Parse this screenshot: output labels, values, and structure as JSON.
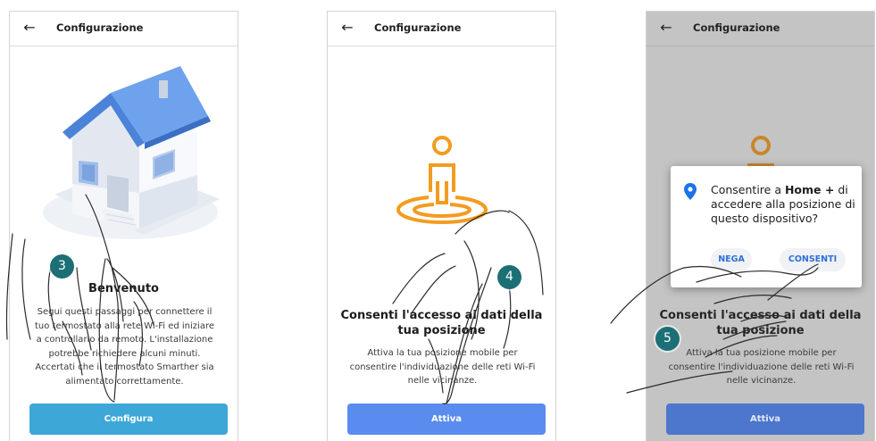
{
  "screens": [
    {
      "header": {
        "back_icon": "arrow-back-icon",
        "title": "Configurazione"
      },
      "illustration": "house-illustration",
      "heading": "Benvenuto",
      "body_lines": [
        "Segui questi passaggi per connettere il",
        "tuo termostato alla rete Wi-Fi ed iniziare",
        "a controllarlo da remoto. L'installazione",
        "potrebbe richiedere alcuni minuti.",
        "Accertati che il termostato Smarther sia",
        "alimentato correttamente."
      ],
      "button": "Configura"
    },
    {
      "header": {
        "back_icon": "arrow-back-icon",
        "title": "Configurazione"
      },
      "illustration": "person-location-icon",
      "heading_lines": [
        "Consenti l'accesso ai dati della",
        "tua posizione"
      ],
      "body_lines": [
        "Attiva la tua posizione mobile per",
        "consentire l'individuazione delle reti Wi-Fi",
        "nelle vicinanze."
      ],
      "button": "Attiva"
    },
    {
      "header": {
        "back_icon": "arrow-back-icon",
        "title": "Configurazione"
      },
      "illustration": "person-location-icon",
      "heading_lines": [
        "Consenti l'accesso ai dati della",
        "tua posizione"
      ],
      "body_lines": [
        "Attiva la tua posizione mobile per",
        "consentire l'individuazione delle reti Wi-Fi",
        "nelle vicinanze."
      ],
      "button": "Attiva",
      "dialog": {
        "icon": "location-pin-icon",
        "text_prefix": "Consentire a ",
        "app_name": "Home +",
        "text_suffix": " di accedere alla posizione di questo dispositivo?",
        "deny": "NEGA",
        "allow": "CONSENTI"
      }
    }
  ],
  "steps": [
    "3",
    "4",
    "5"
  ],
  "colors": {
    "accent_cyan": "#3da8d8",
    "accent_blue": "#5a8cf0",
    "location_orange": "#f39c1f",
    "step_badge": "#1d6f76",
    "dialog_button_text": "#2f6fd6"
  }
}
